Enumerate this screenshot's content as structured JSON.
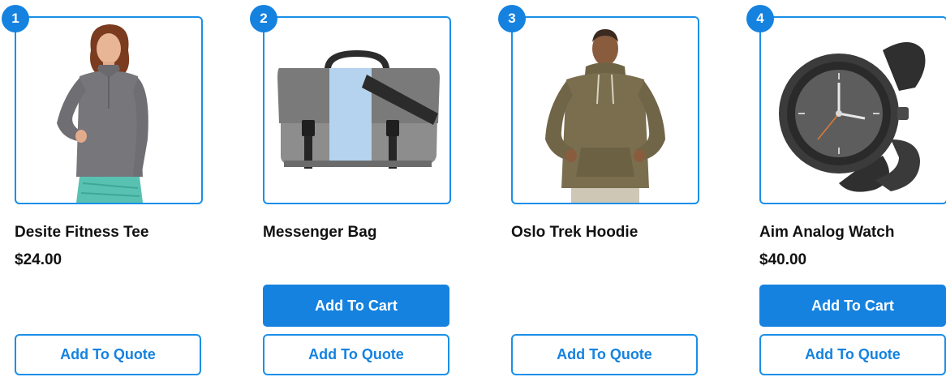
{
  "colors": {
    "accent": "#1582e0",
    "border": "#1a8fe8",
    "text": "#111111"
  },
  "products": [
    {
      "badge": "1",
      "name": "Desite Fitness Tee",
      "price": "$24.00",
      "add_to_cart": "",
      "add_to_quote": "Add To Quote",
      "image_icon": "woman-fitness-tee-image"
    },
    {
      "badge": "2",
      "name": "Messenger Bag",
      "price": "",
      "add_to_cart": "Add To Cart",
      "add_to_quote": "Add To Quote",
      "image_icon": "messenger-bag-image"
    },
    {
      "badge": "3",
      "name": "Oslo Trek Hoodie",
      "price": "",
      "add_to_cart": "",
      "add_to_quote": "Add To Quote",
      "image_icon": "man-hoodie-image"
    },
    {
      "badge": "4",
      "name": "Aim Analog Watch",
      "price": "$40.00",
      "add_to_cart": "Add To Cart",
      "add_to_quote": "Add To Quote",
      "image_icon": "analog-watch-image"
    }
  ]
}
